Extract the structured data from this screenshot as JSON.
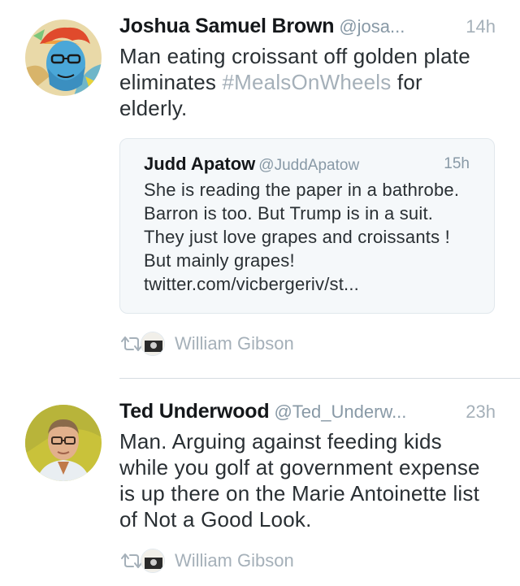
{
  "tweets": [
    {
      "name": "Joshua Samuel Brown",
      "handle": "@josa...",
      "time": "14h",
      "text_before": "Man eating croissant off golden plate eliminates ",
      "hashtag": "#MealsOnWheels",
      "text_after": " for elderly.",
      "quote": {
        "name": "Judd Apatow",
        "handle": "@JuddApatow",
        "time": "15h",
        "text": "She is reading the paper in a bathrobe. Barron is too. But Trump is in a suit. They just love grapes and croissants !  But mainly grapes! twitter.com/vicbergeriv/st..."
      },
      "retweeted_by": "William Gibson"
    },
    {
      "name": "Ted Underwood",
      "handle": "@Ted_Underw...",
      "time": "23h",
      "text": "Man. Arguing against feeding kids while you golf at government expense is up there on the Marie Antoinette list of Not a Good Look.",
      "retweeted_by": "William Gibson"
    }
  ],
  "icons": {
    "retweet": "retweet-icon",
    "colors": {
      "hashtag": "#a5b0b9",
      "muted": "#a5b0b9",
      "quote_bg": "#f5f8fa",
      "border": "#e1e8ed"
    }
  }
}
